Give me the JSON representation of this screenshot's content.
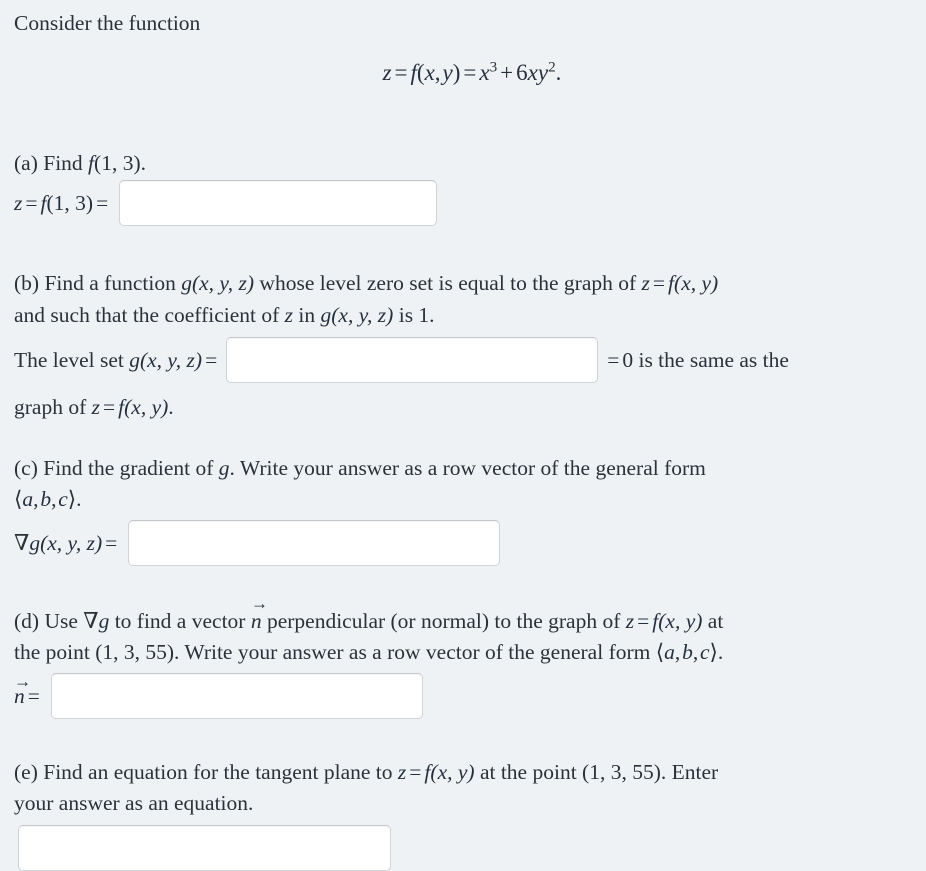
{
  "intro": {
    "text": "Consider the function"
  },
  "equation": {
    "z": "z",
    "eq1": "=",
    "f": "f",
    "open": "(",
    "x": "x",
    "comma": ",",
    "y": "y",
    "close": ")",
    "eq2": "=",
    "x2": "x",
    "exp3": "3",
    "plus": "+",
    "six": "6",
    "x3": "x",
    "y2": "y",
    "exp2": "2",
    "period": "."
  },
  "parts": {
    "a": {
      "prompt": "(a) Find f(1, 3).",
      "prompt_pre": "(a) Find ",
      "prompt_f": "f",
      "prompt_args": "(1, 3).",
      "answer_lead_z": "z",
      "answer_lead_eq1": "=",
      "answer_lead_f": "f",
      "answer_lead_args": "(1, 3)",
      "answer_lead_eq2": "=",
      "input_value": "",
      "input_placeholder": ""
    },
    "b": {
      "line1_pre": "(b) Find a function ",
      "line1_g": "g",
      "line1_gargs": "(x, y, z)",
      "line1_mid": " whose level zero set is equal to the graph of ",
      "line1_z": "z",
      "line1_eq": "=",
      "line1_f": "f",
      "line1_fargs": "(x, y)",
      "line2_pre": "and such that the coefficient of ",
      "line2_z": "z",
      "line2_mid": " in ",
      "line2_g": "g",
      "line2_gargs": "(x, y, z)",
      "line2_post": " is 1.",
      "row_lead_text": "The level set ",
      "row_lead_g": "g",
      "row_lead_gargs": "(x, y, z)",
      "row_lead_eq": "=",
      "input_value": "",
      "input_placeholder": "",
      "row_trail_eq": "=",
      "row_trail_text": "0 is the same as the",
      "tail_pre": "graph of ",
      "tail_z": "z",
      "tail_eq": "=",
      "tail_f": "f",
      "tail_fargs": "(x, y)",
      "tail_period": "."
    },
    "c": {
      "line1_pre": "(c) Find the gradient of ",
      "line1_g": "g",
      "line1_post": ". Write your answer as a row vector of the general form",
      "line2_open": "⟨",
      "line2_a": "a",
      "line2_c1": ",",
      "line2_b": "b",
      "line2_c2": ",",
      "line2_c": "c",
      "line2_close": "⟩",
      "line2_period": ".",
      "row_nabla": "∇",
      "row_g": "g",
      "row_gargs": "(x, y, z)",
      "row_eq": "=",
      "input_value": "",
      "input_placeholder": ""
    },
    "d": {
      "line1_pre": "(d) Use ",
      "line1_nabla": "∇",
      "line1_g": "g",
      "line1_mid": " to find a vector ",
      "line1_n": "n",
      "line1_arrow": "→",
      "line1_mid2": " perpendicular (or normal) to the graph of ",
      "line1_z": "z",
      "line1_eq": "=",
      "line1_f": "f",
      "line1_fargs": "(x, y)",
      "line1_post": " at",
      "line2_pre": "the point (1, 3, 55). Write your answer as a row vector of the general form ",
      "line2_open": "⟨",
      "line2_a": "a",
      "line2_c1": ",",
      "line2_b": "b",
      "line2_c2": ",",
      "line2_c": "c",
      "line2_close": "⟩",
      "line2_period": ".",
      "row_n": "n",
      "row_arrow": "→",
      "row_eq": "=",
      "input_value": "",
      "input_placeholder": ""
    },
    "e": {
      "line1_pre": "(e) Find an equation for the tangent plane to ",
      "line1_z": "z",
      "line1_eq": "=",
      "line1_f": "f",
      "line1_fargs": "(x, y)",
      "line1_post": " at the point (1, 3, 55). Enter",
      "line2": "your answer as an equation.",
      "input_value": "",
      "input_placeholder": ""
    }
  },
  "colors": {
    "page_background": "#eef2f5",
    "text": "#2b3138",
    "math_text": "#25303f",
    "input_background": "#ffffff",
    "input_border": "#cfd4d8"
  }
}
